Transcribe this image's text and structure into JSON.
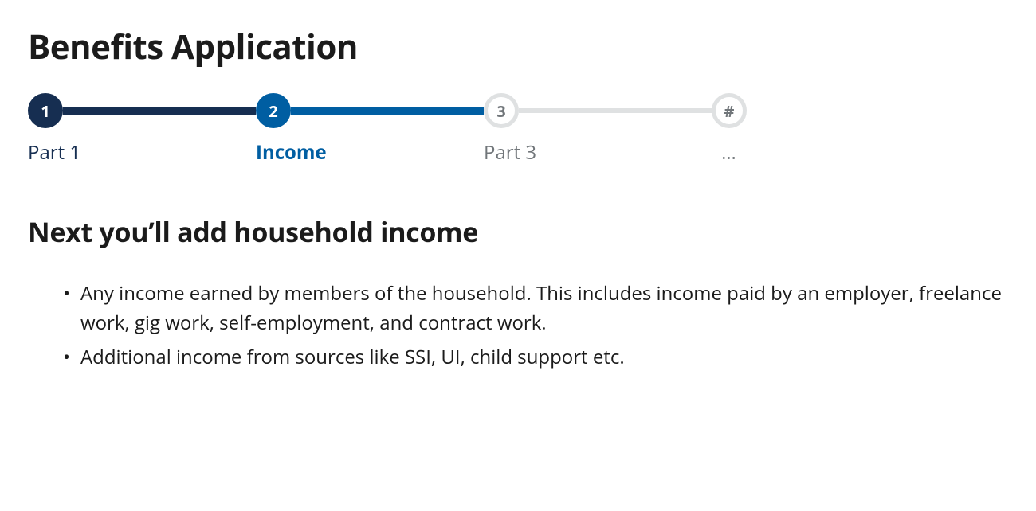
{
  "page": {
    "title": "Benefits Application"
  },
  "stepper": {
    "steps": [
      {
        "number": "1",
        "label": "Part 1",
        "state": "completed"
      },
      {
        "number": "2",
        "label": "Income",
        "state": "current"
      },
      {
        "number": "3",
        "label": "Part 3",
        "state": "upcoming"
      },
      {
        "number": "#",
        "label": "…",
        "state": "upcoming"
      }
    ]
  },
  "section": {
    "heading": "Next you’ll add household income",
    "bullets": [
      "Any income earned by members of the household. This includes income paid by an employer, freelance work, gig work, self-employment, and contract work.",
      "Additional income from sources like SSI, UI, child support etc."
    ]
  }
}
